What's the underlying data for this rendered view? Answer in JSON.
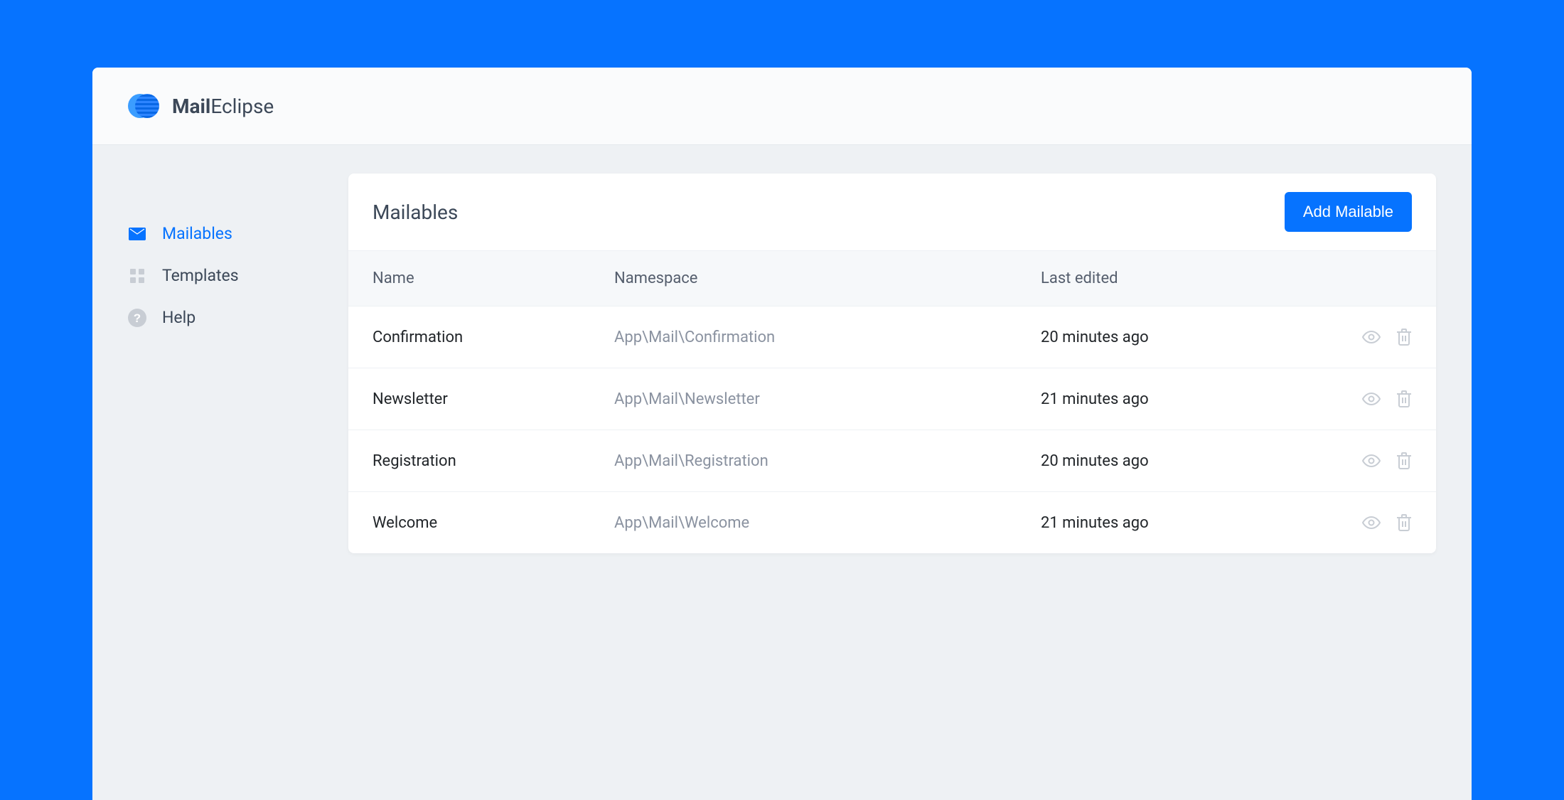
{
  "brand": {
    "name_bold": "Mail",
    "name_regular": "Eclipse"
  },
  "sidebar": {
    "items": [
      {
        "label": "Mailables",
        "icon": "envelope-icon",
        "active": true
      },
      {
        "label": "Templates",
        "icon": "grid-icon",
        "active": false
      },
      {
        "label": "Help",
        "icon": "help-icon",
        "active": false
      }
    ]
  },
  "page": {
    "title": "Mailables",
    "add_button": "Add Mailable"
  },
  "table": {
    "columns": {
      "name": "Name",
      "namespace": "Namespace",
      "last_edited": "Last edited"
    },
    "rows": [
      {
        "name": "Confirmation",
        "namespace": "App\\Mail\\Confirmation",
        "last_edited": "20 minutes ago"
      },
      {
        "name": "Newsletter",
        "namespace": "App\\Mail\\Newsletter",
        "last_edited": "21 minutes ago"
      },
      {
        "name": "Registration",
        "namespace": "App\\Mail\\Registration",
        "last_edited": "20 minutes ago"
      },
      {
        "name": "Welcome",
        "namespace": "App\\Mail\\Welcome",
        "last_edited": "21 minutes ago"
      }
    ]
  },
  "colors": {
    "accent": "#0673ff",
    "background": "#eef1f4",
    "text_primary": "#3c4858",
    "text_muted": "#8a92a0"
  }
}
